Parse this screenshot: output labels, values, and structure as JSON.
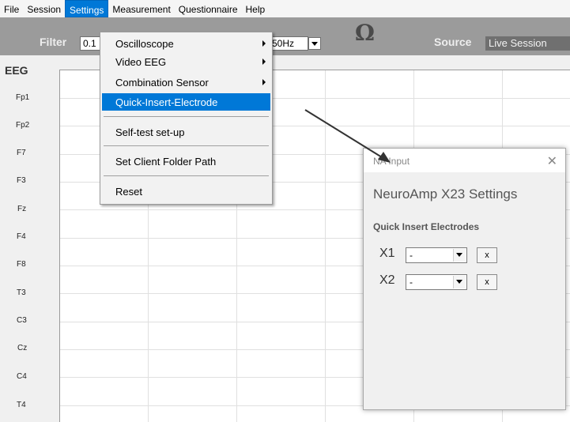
{
  "menubar": {
    "items": [
      "File",
      "Session",
      "Settings",
      "Measurement",
      "Questionnaire",
      "Help"
    ]
  },
  "toolbar": {
    "filter_label": "Filter",
    "filter_value": "0.1",
    "notch_value": "50Hz",
    "impedance_icon": "omega-icon",
    "source_label": "Source",
    "source_value": "Live Session"
  },
  "eeg": {
    "label": "EEG",
    "channels": [
      "Fp1",
      "Fp2",
      "F7",
      "F3",
      "Fz",
      "F4",
      "F8",
      "T3",
      "C3",
      "Cz",
      "C4",
      "T4"
    ]
  },
  "settings_menu": {
    "items": [
      {
        "label": "Oscilloscope"
      },
      {
        "label": "Video EEG"
      },
      {
        "label": "Combination Sensor"
      },
      {
        "label": "Quick-Insert-Electrode"
      },
      {
        "label": "Self-test set-up"
      },
      {
        "label": "Set Client Folder Path"
      },
      {
        "label": "Reset"
      }
    ]
  },
  "dialog": {
    "title": "NA Input",
    "close_glyph": "✕",
    "heading": "NeuroAmp X23 Settings",
    "section": "Quick Insert Electrodes",
    "rows": [
      {
        "label": "X1",
        "value": "-",
        "clear": "x"
      },
      {
        "label": "X2",
        "value": "-",
        "clear": "x"
      }
    ]
  },
  "colors": {
    "menu_highlight": "#0078d7",
    "toolbar": "#9b9b9b",
    "source_field": "#707070"
  }
}
